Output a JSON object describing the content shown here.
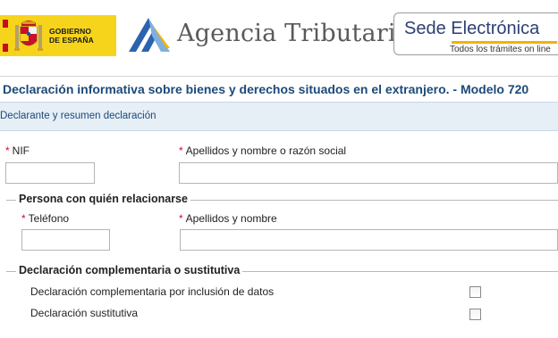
{
  "header": {
    "gov_text_line1": "GOBIERNO",
    "gov_text_line2": "DE ESPAÑA",
    "agency_name": "Agencia Tributaria",
    "sede_word": "Sede",
    "electronica_word": "Electrónica",
    "sede_subtitle": "Todos los trámites on line"
  },
  "colors": {
    "brand_blue": "#1b4a7a",
    "gov_yellow": "#f6d41c",
    "required_red": "#c8102e",
    "section_bar_bg": "#e6eef6",
    "sede_accent": "#f0b400"
  },
  "icons": [
    "spain-coat-of-arms-icon",
    "aeat-logo-icon",
    "checkbox-icon"
  ],
  "model_title": "Declaración informativa sobre bienes y derechos situados en el extranjero. - Modelo 720",
  "section": {
    "title": "Declarante y resumen declaración"
  },
  "declarant": {
    "required_mark": "*",
    "nif_label": "NIF",
    "nif_value": "",
    "name_label": "Apellidos y nombre o razón social",
    "name_value": ""
  },
  "contact": {
    "legend": "Persona con quién relacionarse",
    "required_mark": "*",
    "phone_label": "Teléfono",
    "phone_value": "",
    "name_label": "Apellidos y nombre",
    "name_value": ""
  },
  "complementary": {
    "legend": "Declaración complementaria o sustitutiva",
    "option1_label": "Declaración complementaria por inclusión de datos",
    "option1_checked": false,
    "option2_label": "Declaración sustitutiva",
    "option2_checked": false
  }
}
